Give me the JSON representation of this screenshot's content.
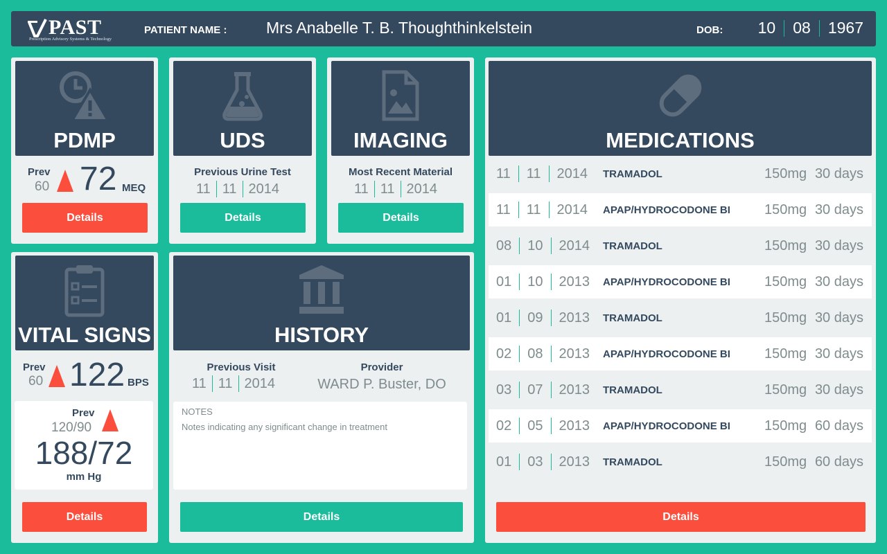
{
  "header": {
    "logo_text": "PAST",
    "logo_subtitle": "Prescription Advisory Systems & Technology",
    "patient_label": "PATIENT NAME :",
    "patient_name": "Mrs Anabelle T. B. Thoughthinkelstein",
    "dob_label": "DOB:",
    "dob": {
      "month": "10",
      "day": "08",
      "year": "1967"
    }
  },
  "pdmp": {
    "title": "PDMP",
    "prev_label": "Prev",
    "prev_value": "60",
    "value": "72",
    "unit": "MEQ",
    "details": "Details"
  },
  "uds": {
    "title": "UDS",
    "label": "Previous Urine Test",
    "date": {
      "month": "11",
      "day": "11",
      "year": "2014"
    },
    "details": "Details"
  },
  "imaging": {
    "title": "IMAGING",
    "label": "Most Recent Material",
    "date": {
      "month": "11",
      "day": "11",
      "year": "2014"
    },
    "details": "Details"
  },
  "vitals": {
    "title": "VITAL SIGNS",
    "hr_prev_label": "Prev",
    "hr_prev_value": "60",
    "hr_value": "122",
    "hr_unit": "BPS",
    "bp_prev_label": "Prev",
    "bp_prev_value": "120/90",
    "bp_value": "188/72",
    "bp_unit": "mm Hg",
    "details": "Details"
  },
  "history": {
    "title": "HISTORY",
    "visit_label": "Previous Visit",
    "visit_date": {
      "month": "11",
      "day": "11",
      "year": "2014"
    },
    "provider_label": "Provider",
    "provider": "WARD P. Buster, DO",
    "notes_label": "NOTES",
    "notes_text": "Notes indicating any significant change in treatment",
    "details": "Details"
  },
  "medications": {
    "title": "MEDICATIONS",
    "rows": [
      {
        "month": "11",
        "day": "11",
        "year": "2014",
        "name": "TRAMADOL",
        "dose": "150mg",
        "days": "30 days"
      },
      {
        "month": "11",
        "day": "11",
        "year": "2014",
        "name": "APAP/HYDROCODONE BI",
        "dose": "150mg",
        "days": "30 days"
      },
      {
        "month": "08",
        "day": "10",
        "year": "2014",
        "name": "TRAMADOL",
        "dose": "150mg",
        "days": "30 days"
      },
      {
        "month": "01",
        "day": "10",
        "year": "2013",
        "name": "APAP/HYDROCODONE BI",
        "dose": "150mg",
        "days": "30 days"
      },
      {
        "month": "01",
        "day": "09",
        "year": "2013",
        "name": "TRAMADOL",
        "dose": "150mg",
        "days": "30 days"
      },
      {
        "month": "02",
        "day": "08",
        "year": "2013",
        "name": "APAP/HYDROCODONE BI",
        "dose": "150mg",
        "days": "30 days"
      },
      {
        "month": "03",
        "day": "07",
        "year": "2013",
        "name": "TRAMADOL",
        "dose": "150mg",
        "days": "30 days"
      },
      {
        "month": "02",
        "day": "05",
        "year": "2013",
        "name": "APAP/HYDROCODONE BI",
        "dose": "150mg",
        "days": "60 days"
      },
      {
        "month": "01",
        "day": "03",
        "year": "2013",
        "name": "TRAMADOL",
        "dose": "150mg",
        "days": "60 days"
      }
    ],
    "details": "Details"
  },
  "colors": {
    "accent": "#1abc9c",
    "panel_dark": "#34495e",
    "alert": "#fc4e3c",
    "background_light": "#ecf0f1"
  },
  "icons": {
    "pdmp": "clock-warning-icon",
    "uds": "flask-icon",
    "imaging": "image-file-icon",
    "vitals": "clipboard-icon",
    "history": "building-icon",
    "medications": "pill-icon"
  }
}
